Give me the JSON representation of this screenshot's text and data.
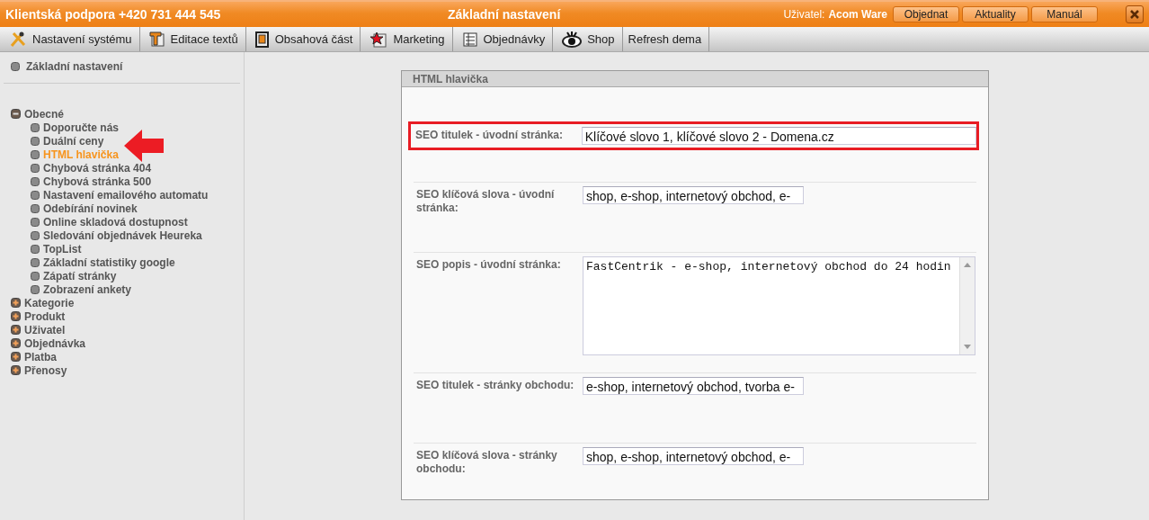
{
  "top_bar": {
    "support": "Klientská podpora +420 731 444 545",
    "title": "Základní nastavení",
    "user_label": "Uživatel:",
    "user_name": "Acom Ware",
    "buttons": [
      "Objednat",
      "Aktuality",
      "Manuál"
    ]
  },
  "toolbar": [
    {
      "label": "Nastavení systému",
      "kind": "tools"
    },
    {
      "label": "Editace textů",
      "kind": "text"
    },
    {
      "label": "Obsahová část",
      "kind": "page"
    },
    {
      "label": "Marketing",
      "kind": "star"
    },
    {
      "label": "Objednávky",
      "kind": "list"
    },
    {
      "label": "Shop",
      "kind": "eye"
    },
    {
      "label": "Refresh dema",
      "kind": "plain"
    }
  ],
  "sidebar": {
    "top_item": "Základní nastavení",
    "groups": [
      {
        "label": "Obecné",
        "expanded": true,
        "children": [
          {
            "label": "Doporučte nás",
            "selected": false
          },
          {
            "label": "Duální ceny",
            "selected": false
          },
          {
            "label": "HTML hlavička",
            "selected": true
          },
          {
            "label": "Chybová stránka 404",
            "selected": false
          },
          {
            "label": "Chybová stránka 500",
            "selected": false
          },
          {
            "label": "Nastavení emailového automatu",
            "selected": false
          },
          {
            "label": "Odebírání novinek",
            "selected": false
          },
          {
            "label": "Online skladová dostupnost",
            "selected": false
          },
          {
            "label": "Sledování objednávek Heureka",
            "selected": false
          },
          {
            "label": "TopList",
            "selected": false
          },
          {
            "label": "Základní statistiky google",
            "selected": false
          },
          {
            "label": "Zápatí stránky",
            "selected": false
          },
          {
            "label": "Zobrazení ankety",
            "selected": false
          }
        ]
      },
      {
        "label": "Kategorie",
        "expanded": false
      },
      {
        "label": "Produkt",
        "expanded": false
      },
      {
        "label": "Uživatel",
        "expanded": false
      },
      {
        "label": "Objednávka",
        "expanded": false
      },
      {
        "label": "Platba",
        "expanded": false
      },
      {
        "label": "Přenosy",
        "expanded": false
      }
    ]
  },
  "panel": {
    "title": "HTML hlavička",
    "fields": [
      {
        "kind": "wide",
        "label": "SEO titulek - úvodní stránka:",
        "value": "Klíčové slovo 1, klíčové slovo 2 - Domena.cz",
        "highlighted": true
      },
      {
        "kind": "input",
        "label": "SEO klíčová slova - úvodní stránka:",
        "value": "shop, e-shop, internetový obchod, e-",
        "highlighted": false
      },
      {
        "kind": "textarea",
        "label": "SEO popis - úvodní stránka:",
        "value": "FastCentrik - e-shop, internetový obchod do 24 hodin",
        "highlighted": false
      },
      {
        "kind": "input",
        "label": "SEO titulek - stránky obchodu:",
        "value": "e-shop, internetový obchod, tvorba e-",
        "highlighted": false
      },
      {
        "kind": "input",
        "label": "SEO klíčová slova - stránky obchodu:",
        "value": "shop, e-shop, internetový obchod, e-",
        "highlighted": false
      }
    ]
  }
}
